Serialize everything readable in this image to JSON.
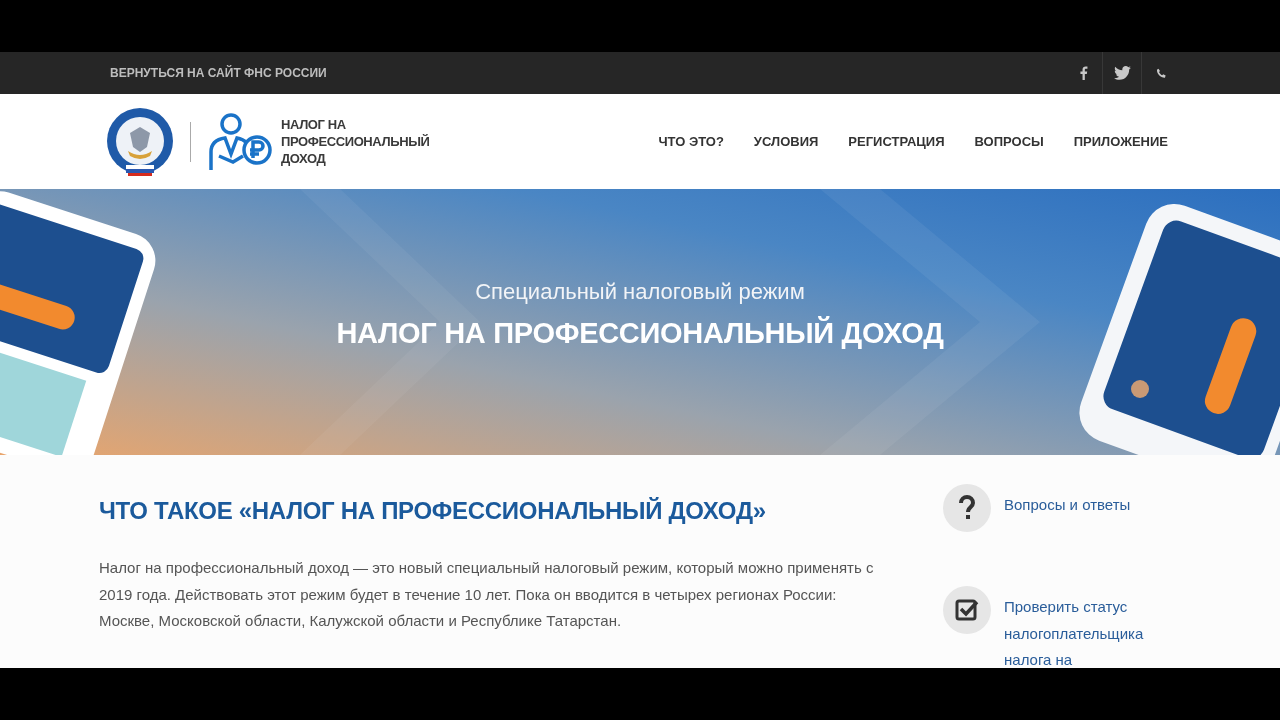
{
  "top_bar": {
    "back_link": "ВЕРНУТЬСЯ НА САЙТ ФНС РОССИИ",
    "social": [
      {
        "kind": "facebook"
      },
      {
        "kind": "twitter"
      },
      {
        "kind": "phone"
      }
    ]
  },
  "header": {
    "brand": "НАЛОГ НА ПРОФЕССИОНАЛЬНЫЙ ДОХОД",
    "nav": [
      "ЧТО ЭТО?",
      "УСЛОВИЯ",
      "РЕГИСТРАЦИЯ",
      "ВОПРОСЫ",
      "ПРИЛОЖЕНИЕ"
    ]
  },
  "hero": {
    "kind": "picture",
    "subtitle": "Специальный налоговый режим",
    "title": "НАЛОГ НА ПРОФЕССИОНАЛЬНЫЙ ДОХОД"
  },
  "article": {
    "heading": "ЧТО ТАКОЕ «НАЛОГ НА ПРОФЕССИОНАЛЬНЫЙ ДОХОД»",
    "text": "Налог на профессиональный доход — это новый специальный налоговый режим, который можно применять с 2019 года. Действовать этот режим будет в течение 10 лет. Пока он вводится в четырех регионах России: Москве, Московской области, Калужской области и Республике Татарстан."
  },
  "sidebar": [
    {
      "kind": "question",
      "label": "Вопросы и ответы"
    },
    {
      "kind": "check",
      "label": "Проверить статус налогоплательщика налога на"
    }
  ]
}
